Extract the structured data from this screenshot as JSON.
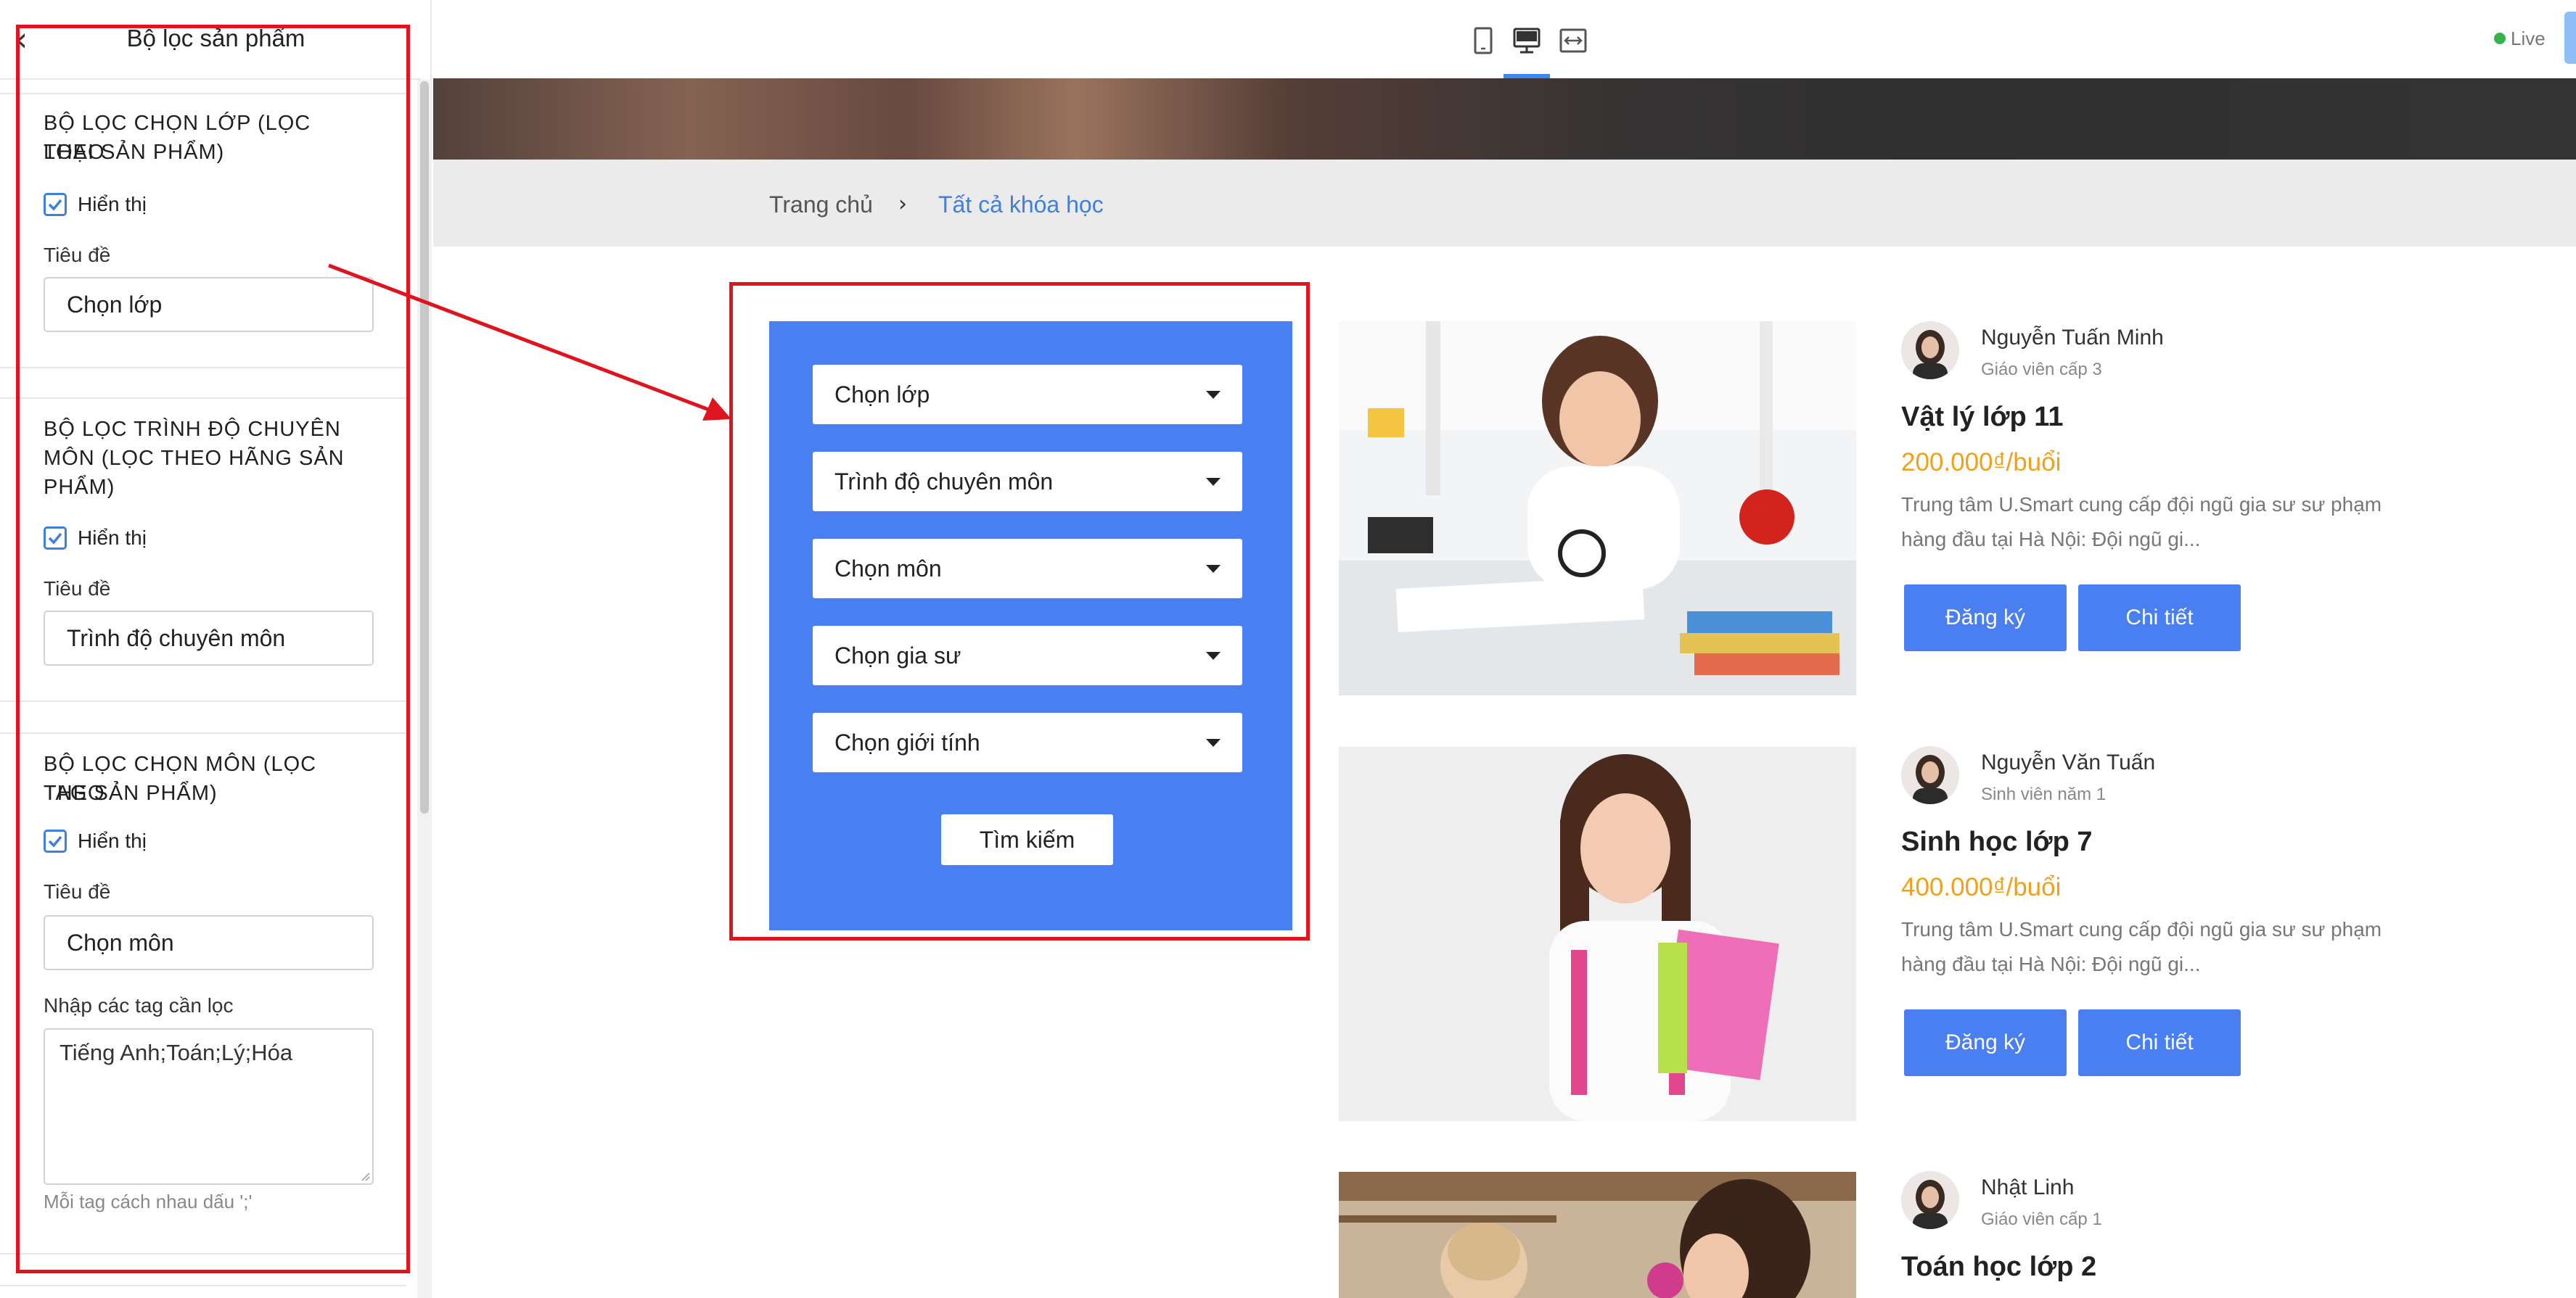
{
  "sidebar": {
    "title": "Bộ lọc sản phẩm",
    "sections": [
      {
        "heading_line1": "BỘ LỌC CHỌN LỚP (LỌC THEO",
        "heading_line2": "LOẠI SẢN PHẨM)",
        "show_label": "Hiển thị",
        "show_checked": true,
        "title_label": "Tiêu đề",
        "title_value": "Chọn lớp"
      },
      {
        "heading_line1": "BỘ LỌC TRÌNH ĐỘ CHUYÊN",
        "heading_line2": "MÔN (LỌC THEO HÃNG SẢN",
        "heading_line3": "PHẨM)",
        "show_label": "Hiển thị",
        "show_checked": true,
        "title_label": "Tiêu đề",
        "title_value": "Trình độ chuyên môn"
      },
      {
        "heading_line1": "BỘ LỌC CHỌN MÔN (LỌC THEO",
        "heading_line2": "TAG SẢN PHẨM)",
        "show_label": "Hiển thị",
        "show_checked": true,
        "title_label": "Tiêu đề",
        "title_value": "Chọn môn",
        "tags_label": "Nhập các tag cần lọc",
        "tags_value": "Tiếng Anh;Toán;Lý;Hóa",
        "tags_hint": "Mỗi tag cách nhau dấu ';'"
      }
    ]
  },
  "toolbar": {
    "icons": [
      "tablet-icon",
      "desktop-icon",
      "fit-width-icon"
    ],
    "active_icon": "desktop-icon",
    "live_label": "Live"
  },
  "breadcrumb": {
    "home": "Trang chủ",
    "separator": "›",
    "current": "Tất cả khóa học"
  },
  "filter": {
    "dropdowns": [
      "Chọn lớp",
      "Trình độ chuyên môn",
      "Chọn môn",
      "Chọn gia sư",
      "Chọn giới tính"
    ],
    "search_label": "Tìm kiếm"
  },
  "courses": [
    {
      "teacher": "Nguyễn Tuấn Minh",
      "role": "Giáo viên cấp 3",
      "title": "Vật lý lớp 11",
      "price": "200.000₫/buổi",
      "desc_line1": "Trung tâm U.Smart cung cấp đội ngũ gia sư sư phạm",
      "desc_line2": "hàng đầu tại Hà Nội: Đội ngũ gi...",
      "register_label": "Đăng ký",
      "detail_label": "Chi tiết"
    },
    {
      "teacher": "Nguyễn Văn Tuấn",
      "role": "Sinh viên năm 1",
      "title": "Sinh học lớp 7",
      "price": "400.000₫/buổi",
      "desc_line1": "Trung tâm U.Smart cung cấp đội ngũ gia sư sư phạm",
      "desc_line2": "hàng đầu tại Hà Nội: Đội ngũ gi...",
      "register_label": "Đăng ký",
      "detail_label": "Chi tiết"
    },
    {
      "teacher": "Nhật Linh",
      "role": "Giáo viên cấp 1",
      "title": "Toán học lớp 2"
    }
  ],
  "colors": {
    "accent": "#4a7ff2",
    "price": "#f0a019",
    "annotation_red": "#e0141e",
    "live_dot": "#35b34a"
  }
}
